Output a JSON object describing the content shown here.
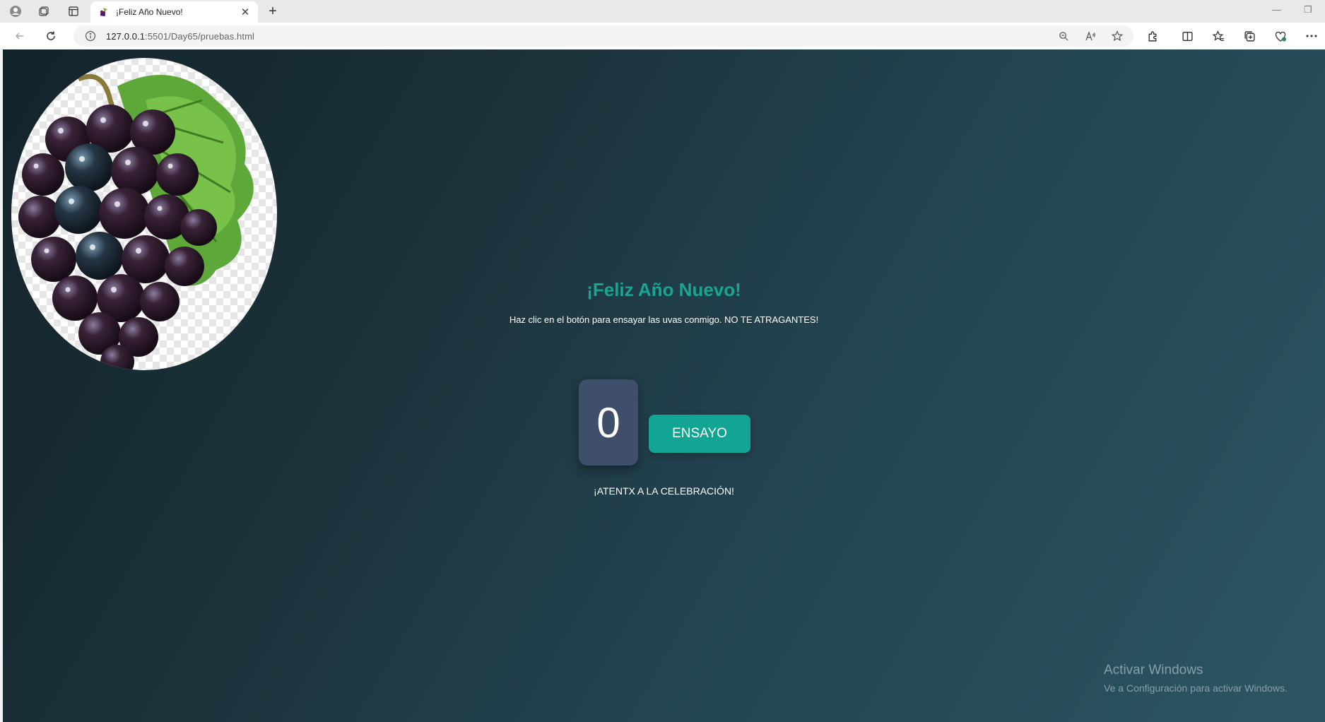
{
  "browser": {
    "tab_title": "¡Feliz Año Nuevo!",
    "url_host": "127.0.0.1",
    "url_rest": ":5501/Day65/pruebas.html"
  },
  "page": {
    "heading": "¡Feliz Año Nuevo!",
    "subtext": "Haz clic en el botón para ensayar las uvas conmigo. NO TE ATRAGANTES!",
    "counter_value": "0",
    "button_label": "ENSAYO",
    "footer_message": "¡ATENTX A LA CELEBRACIÓN!"
  },
  "watermark": {
    "line1": "Activar Windows",
    "line2": "Ve a Configuración para activar Windows."
  },
  "colors": {
    "accent": "#12a593",
    "counter_bg": "#3f4f6b",
    "bg_start": "#13232b",
    "bg_end": "#2c5565"
  }
}
